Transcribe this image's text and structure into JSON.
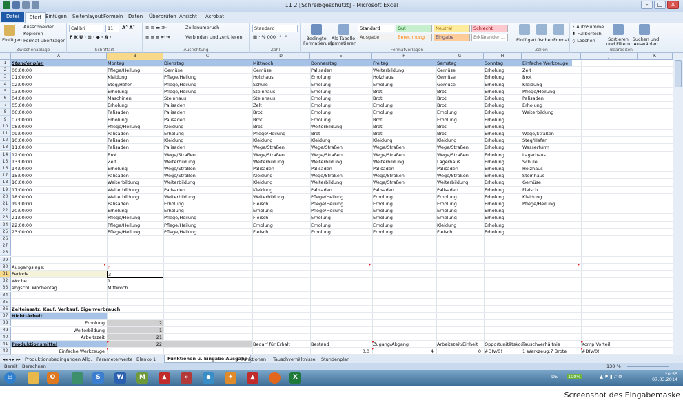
{
  "window": {
    "title": "11 2 [Schreibgeschützt] - Microsoft Excel"
  },
  "ribbon_tabs": [
    "Datei",
    "Start",
    "Einfügen",
    "Seitenlayout",
    "Formeln",
    "Daten",
    "Überprüfen",
    "Ansicht",
    "Acrobat"
  ],
  "ribbon": {
    "paste": "Einfügen",
    "cut": "Ausschneiden",
    "copy": "Kopieren",
    "format_painter": "Format übertragen",
    "g_clipboard": "Zwischenablage",
    "font_name": "Calibri",
    "font_size": "11",
    "g_font": "Schriftart",
    "wrap": "Zeilenumbruch",
    "merge": "Verbinden und zentrieren",
    "g_align": "Ausrichtung",
    "number_format": "Standard",
    "g_number": "Zahl",
    "cond_format": "Bedingte Formatierung",
    "as_table": "Als Tabelle formatieren",
    "styles": [
      {
        "label": "Standard",
        "bg": "#ffffff",
        "fg": "#000000"
      },
      {
        "label": "Gut",
        "bg": "#c6efce",
        "fg": "#006100"
      },
      {
        "label": "Neutral",
        "bg": "#ffeb9c",
        "fg": "#9c6500"
      },
      {
        "label": "Schlecht",
        "bg": "#ffc7ce",
        "fg": "#9c0006"
      },
      {
        "label": "Ausgabe",
        "bg": "#f2f2f2",
        "fg": "#3f3f3f"
      },
      {
        "label": "Berechnung",
        "bg": "#f2f2f2",
        "fg": "#fa7d00"
      },
      {
        "label": "Eingabe",
        "bg": "#ffcc99",
        "fg": "#3f3f76"
      },
      {
        "label": "Erklärender ...",
        "bg": "#ffffff",
        "fg": "#7f7f7f"
      }
    ],
    "g_styles": "Formatvorlagen",
    "insert": "Einfügen",
    "delete": "Löschen",
    "format": "Format",
    "g_cells": "Zellen",
    "autosum": "AutoSumme",
    "fill": "Füllbereich",
    "clear": "Löschen",
    "sort": "Sortieren und Filtern",
    "find": "Suchen und Auswählen",
    "g_edit": "Bearbeiten"
  },
  "columns": [
    "A",
    "B",
    "C",
    "D",
    "E",
    "F",
    "G",
    "H",
    "I",
    "J",
    "K"
  ],
  "rows": [
    {
      "n": "1",
      "blue": true,
      "c": [
        "Stundenplan",
        "Montag",
        "Dienstag",
        "Mittwoch",
        "Donnerstag",
        "Freitag",
        "Samstag",
        "Sonntag",
        "Einfache Werkzeuge"
      ]
    },
    {
      "n": "2",
      "c": [
        "00:00:00",
        "Pflege/Heilung",
        "Gemüse",
        "Gemüse",
        "Palisaden",
        "Weiterbildung",
        "Gemüse",
        "Erholung",
        "Zelt"
      ]
    },
    {
      "n": "3",
      "c": [
        "01:00:00",
        "Kleidung",
        "Pflege/Heilung",
        "Holzhaus",
        "Erholung",
        "Holzhaus",
        "Gemüse",
        "Erholung",
        "Brot"
      ]
    },
    {
      "n": "4",
      "c": [
        "02:00:00",
        "Steg/Hafen",
        "Pflege/Heilung",
        "Schule",
        "Erholung",
        "Erholung",
        "Gemüse",
        "Erholung",
        "Kleidung"
      ]
    },
    {
      "n": "5",
      "c": [
        "03:00:00",
        "Erholung",
        "Pflege/Heilung",
        "Steinhaus",
        "Erholung",
        "Brot",
        "Brot",
        "Erholung",
        "Pflege/Heilung"
      ]
    },
    {
      "n": "6",
      "c": [
        "04:00:00",
        "Maschinen",
        "Steinhaus",
        "Steinhaus",
        "Erholung",
        "Brot",
        "Brot",
        "Erholung",
        "Palisaden"
      ]
    },
    {
      "n": "7",
      "c": [
        "05:00:00",
        "Erholung",
        "Palisaden",
        "Zelt",
        "Erholung",
        "Erholung",
        "Brot",
        "Erholung",
        "Erholung"
      ]
    },
    {
      "n": "8",
      "c": [
        "06:00:00",
        "Palisaden",
        "Palisaden",
        "Brot",
        "Erholung",
        "Erholung",
        "Erholung",
        "Erholung",
        "Weiterbildung"
      ]
    },
    {
      "n": "9",
      "c": [
        "07:00:00",
        "Erholung",
        "Palisaden",
        "Brot",
        "Erholung",
        "Brot",
        "Erholung",
        "Erholung",
        ""
      ]
    },
    {
      "n": "10",
      "c": [
        "08:00:00",
        "Pflege/Heilung",
        "Kleidung",
        "Brot",
        "Weiterbildung",
        "Brot",
        "Brot",
        "Erholung",
        ""
      ]
    },
    {
      "n": "11",
      "c": [
        "09:00:00",
        "Palisaden",
        "Erholung",
        "Pflege/Heilung",
        "Brot",
        "Brot",
        "Brot",
        "Erholung",
        "Wege/Straßen"
      ]
    },
    {
      "n": "12",
      "c": [
        "10:00:00",
        "Palisaden",
        "Kleidung",
        "Kleidung",
        "Kleidung",
        "Kleidung",
        "Kleidung",
        "Erholung",
        "Steg/Hafen"
      ]
    },
    {
      "n": "13",
      "c": [
        "11:00:00",
        "Palisaden",
        "Palisaden",
        "Wege/Straßen",
        "Wege/Straßen",
        "Wege/Straßen",
        "Wege/Straßen",
        "Erholung",
        "Wasserturm"
      ]
    },
    {
      "n": "14",
      "c": [
        "12:00:00",
        "Brot",
        "Wege/Straßen",
        "Wege/Straßen",
        "Wege/Straßen",
        "Wege/Straßen",
        "Wege/Straßen",
        "Erholung",
        "Lagerhaus"
      ]
    },
    {
      "n": "15",
      "c": [
        "13:00:00",
        "Zelt",
        "Weiterbildung",
        "Weiterbildung",
        "Weiterbildung",
        "Weiterbildung",
        "Lagerhaus",
        "Erholung",
        "Schule"
      ]
    },
    {
      "n": "16",
      "c": [
        "14:00:00",
        "Erholung",
        "Wege/Straßen",
        "Palisaden",
        "Palisaden",
        "Palisaden",
        "Palisaden",
        "Erholung",
        "Holzhaus"
      ]
    },
    {
      "n": "17",
      "c": [
        "15:00:00",
        "Palisaden",
        "Wege/Straßen",
        "Kleidung",
        "Wege/Straßen",
        "Wege/Straßen",
        "Wege/Straßen",
        "Erholung",
        "Steinhaus"
      ]
    },
    {
      "n": "18",
      "c": [
        "16:00:00",
        "Weiterbildung",
        "Weiterbildung",
        "Kleidung",
        "Weiterbildung",
        "Wege/Straßen",
        "Weiterbildung",
        "Erholung",
        "Gemüse"
      ]
    },
    {
      "n": "19",
      "c": [
        "17:00:00",
        "Weiterbildung",
        "Palisaden",
        "Kleidung",
        "Palisaden",
        "Palisaden",
        "Palisaden",
        "Erholung",
        "Fleisch"
      ]
    },
    {
      "n": "20",
      "c": [
        "18:00:00",
        "Weiterbildung",
        "Weiterbildung",
        "Weiterbildung",
        "Pflege/Heilung",
        "Erholung",
        "Erholung",
        "Erholung",
        "Kleidung"
      ]
    },
    {
      "n": "21",
      "c": [
        "19:00:00",
        "Palisaden",
        "Erholung",
        "Fleisch",
        "Pflege/Heilung",
        "Erholung",
        "Erholung",
        "Erholung",
        "Pflege/Heilung"
      ]
    },
    {
      "n": "22",
      "c": [
        "20:00:00",
        "Erholung",
        "Erholung",
        "Erholung",
        "Pflege/Heilung",
        "Erholung",
        "Erholung",
        "Erholung",
        ""
      ]
    },
    {
      "n": "23",
      "c": [
        "21:00:00",
        "Pflege/Heilung",
        "Pflege/Heilung",
        "Fleisch",
        "Erholung",
        "Erholung",
        "Erholung",
        "Erholung",
        ""
      ]
    },
    {
      "n": "24",
      "c": [
        "22:00:00",
        "Pflege/Heilung",
        "Pflege/Heilung",
        "Erholung",
        "Erholung",
        "Erholung",
        "Kleidung",
        "Erholung",
        ""
      ]
    },
    {
      "n": "25",
      "c": [
        "23:00:00",
        "Pflege/Heilung",
        "Pflege/Heilung",
        "Fleisch",
        "Erholung",
        "Erholung",
        "Fleisch",
        "Erholung",
        ""
      ]
    },
    {
      "n": "26",
      "c": []
    },
    {
      "n": "27",
      "c": []
    },
    {
      "n": "28",
      "c": []
    },
    {
      "n": "29",
      "c": []
    },
    {
      "n": "30",
      "c": [
        "Ausgangslage:",
        "n"
      ]
    },
    {
      "n": "31",
      "c": [
        "Periode",
        "3"
      ]
    },
    {
      "n": "32",
      "c": [
        "Woche",
        "1"
      ]
    },
    {
      "n": "33",
      "c": [
        "abgschl. Wochentag",
        "Mittwoch"
      ]
    },
    {
      "n": "34",
      "c": []
    },
    {
      "n": "35",
      "c": []
    },
    {
      "n": "36",
      "c": [
        "Zeiteinsatz, Kauf, Verkauf, Eigenverbrauch"
      ]
    },
    {
      "n": "37",
      "c": [
        "Nicht-Arbeit"
      ]
    },
    {
      "n": "38",
      "c": [
        "Erholung",
        "2"
      ]
    },
    {
      "n": "39",
      "c": [
        "Weiterbildung",
        "1"
      ]
    },
    {
      "n": "40",
      "c": [
        "Arbeitszeit",
        "21"
      ]
    },
    {
      "n": "41",
      "c": [
        "Produktionsmittel",
        "22",
        "",
        "Bedarf für Erhalt",
        "Bestand",
        "Zugang/Abgang",
        "Arbeitszeit/Einheit",
        "Opportunitätskos",
        "Tauschverhältnis",
        "Komp Vorteil"
      ]
    },
    {
      "n": "42",
      "c": [
        "Einfache Werkzeuge",
        "",
        "",
        "",
        "0,0",
        "4",
        "0",
        "#DIV/0!",
        "1 Werkzeug:7 Brote",
        "#DIV/0!"
      ]
    }
  ],
  "sheet_tabs": [
    "Produktionsbedingungen Allg.",
    "Parameterwerte",
    "Blanko 1",
    "Funktionen u. Eingabe Ausgabe",
    "Funktionen",
    "Tauschverhältnisse",
    "Stundenplan"
  ],
  "status": {
    "ready": "Bereit",
    "calc": "Berechnen",
    "zoom": "130 %"
  },
  "taskbar": {
    "lang": "DE",
    "battery": "100%",
    "time": "20:55",
    "date": "07.03.2014"
  },
  "caption": "Screenshot des Eingabemaske"
}
